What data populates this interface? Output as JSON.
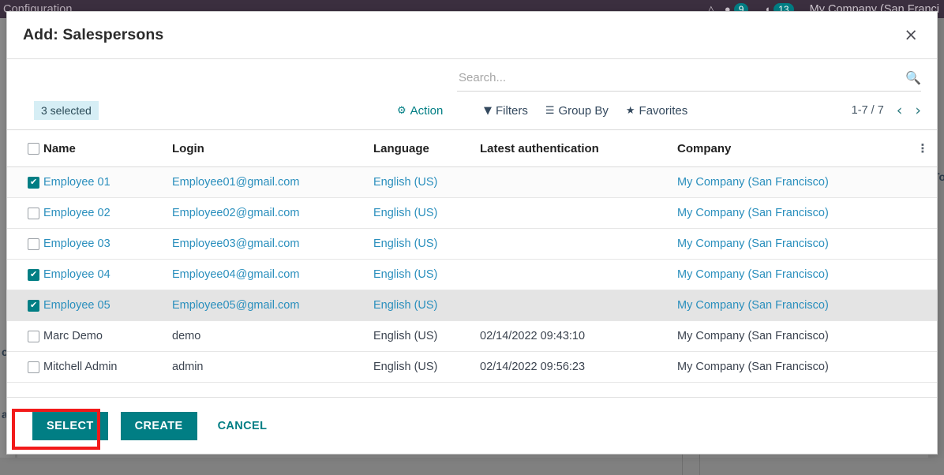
{
  "background": {
    "navbar": {
      "menu_label": "Configuration",
      "badge_messages": "9",
      "badge_activities": "13",
      "company": "My Company (San Franci",
      "icon_hat": "graduation-cap-icon",
      "icon_chat": "chat-bubble-icon",
      "icon_clock": "clock-icon"
    },
    "snippets": {
      "left_mid": "cu",
      "left_low": "a",
      "right_mid": "To"
    }
  },
  "modal": {
    "title": "Add: Salespersons",
    "close_label": "×",
    "search": {
      "placeholder": "Search...",
      "value": "",
      "icon": "search-icon"
    },
    "toolbar": {
      "selected_badge": "3 selected",
      "action_label": "Action",
      "action_icon": "gear-icon",
      "filters_label": "Filters",
      "filters_icon": "filter-icon",
      "group_by_label": "Group By",
      "group_by_icon": "list-icon",
      "favorites_label": "Favorites",
      "favorites_icon": "star-icon",
      "pager_count": "1-7 / 7",
      "pager_prev": "‹",
      "pager_next": "›"
    },
    "table": {
      "columns": [
        "Name",
        "Login",
        "Language",
        "Latest authentication",
        "Company"
      ],
      "header_select_all_checked": false,
      "options_icon": "vertical-dots-icon",
      "rows": [
        {
          "checked": true,
          "name": "Employee 01",
          "login": "Employee01@gmail.com",
          "language": "English (US)",
          "latest_authentication": "",
          "company": "My Company (San Francisco)",
          "is_link": true,
          "state": "selected-top"
        },
        {
          "checked": false,
          "name": "Employee 02",
          "login": "Employee02@gmail.com",
          "language": "English (US)",
          "latest_authentication": "",
          "company": "My Company (San Francisco)",
          "is_link": true,
          "state": ""
        },
        {
          "checked": false,
          "name": "Employee 03",
          "login": "Employee03@gmail.com",
          "language": "English (US)",
          "latest_authentication": "",
          "company": "My Company (San Francisco)",
          "is_link": true,
          "state": ""
        },
        {
          "checked": true,
          "name": "Employee 04",
          "login": "Employee04@gmail.com",
          "language": "English (US)",
          "latest_authentication": "",
          "company": "My Company (San Francisco)",
          "is_link": true,
          "state": ""
        },
        {
          "checked": true,
          "name": "Employee 05",
          "login": "Employee05@gmail.com",
          "language": "English (US)",
          "latest_authentication": "",
          "company": "My Company (San Francisco)",
          "is_link": true,
          "state": "hover"
        },
        {
          "checked": false,
          "name": "Marc Demo",
          "login": "demo",
          "language": "English (US)",
          "latest_authentication": "02/14/2022 09:43:10",
          "company": "My Company (San Francisco)",
          "is_link": false,
          "state": ""
        },
        {
          "checked": false,
          "name": "Mitchell Admin",
          "login": "admin",
          "language": "English (US)",
          "latest_authentication": "02/14/2022 09:56:23",
          "company": "My Company (San Francisco)",
          "is_link": false,
          "state": ""
        }
      ]
    },
    "footer": {
      "select_label": "SELECT",
      "create_label": "CREATE",
      "cancel_label": "CANCEL"
    }
  },
  "colors": {
    "accent_teal": "#017e84",
    "link_blue": "#2a8fbd",
    "badge_bg": "#d6eef5",
    "navbar_bg": "#3b2f3f",
    "highlight_red": "#f21a1a",
    "overlay_gray": "#8a8a8a"
  }
}
